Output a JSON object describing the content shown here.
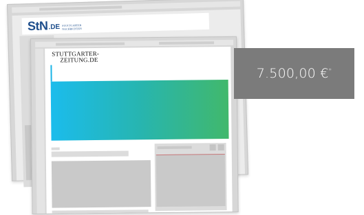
{
  "back_window": {
    "logo": {
      "main": "StN",
      "suffix": ".DE",
      "sub_line1": "STUTTGARTER",
      "sub_line2": "NACHRICHTEN"
    }
  },
  "front_window": {
    "logo": {
      "line1": "STUTTGARTER-",
      "line2": "ZEITUNG.DE"
    },
    "hero_colors": [
      "#1bbcec",
      "#27b5b0",
      "#41b86c"
    ]
  },
  "price": {
    "amount": "7.500,00 €",
    "footnote": "*"
  }
}
